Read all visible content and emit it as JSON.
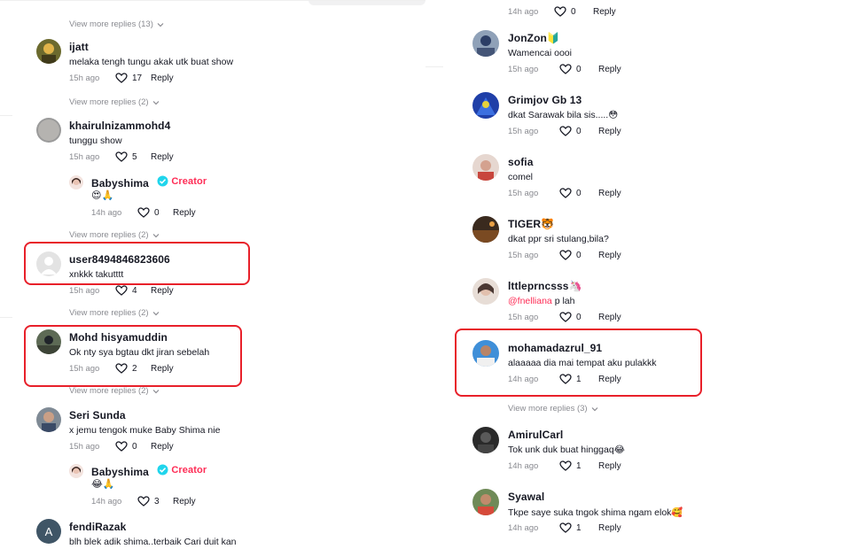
{
  "colors": {
    "accent": "#fe2c55",
    "verified": "#20d5ec",
    "highlight": "#e8202a",
    "muted": "#8a8b91"
  },
  "left": {
    "view_more_1": "View more replies (13)",
    "c1": {
      "username": "ijatt",
      "text": "melaka tengh tungu akak utk buat show",
      "time": "15h ago",
      "likes": "17",
      "reply": "Reply"
    },
    "view_more_2": "View more replies (2)",
    "c2": {
      "username": "khairulnizammohd4",
      "text": "tunggu show",
      "time": "15h ago",
      "likes": "5",
      "reply": "Reply"
    },
    "r1": {
      "username": "Babyshima",
      "creator": "Creator",
      "text": "😍🙏",
      "time": "14h ago",
      "likes": "0",
      "reply": "Reply"
    },
    "view_more_3": "View more replies (2)",
    "c3": {
      "username": "user8494846823606",
      "text": "xnkkk takutttt",
      "time": "15h ago",
      "likes": "4",
      "reply": "Reply"
    },
    "view_more_4": "View more replies (2)",
    "c4": {
      "username": "Mohd hisyamuddin",
      "text": "Ok nty sya bgtau dkt jiran sebelah",
      "time": "15h ago",
      "likes": "2",
      "reply": "Reply"
    },
    "view_more_5": "View more replies (2)",
    "c5": {
      "username": "Seri Sunda",
      "text": "x jemu tengok muke Baby Shima nie",
      "time": "15h ago",
      "likes": "0",
      "reply": "Reply"
    },
    "r2": {
      "username": "Babyshima",
      "creator": "Creator",
      "text": "😂🙏",
      "time": "14h ago",
      "likes": "3",
      "reply": "Reply"
    },
    "c6": {
      "username": "fendiRazak",
      "avatar_letter": "A",
      "text": "blh blek adik shima..terbaik Cari duit kan"
    }
  },
  "right": {
    "top": {
      "time": "14h ago",
      "likes": "0",
      "reply": "Reply"
    },
    "c1": {
      "username": "JonZon🔰",
      "text": "Wamencai oooi",
      "time": "15h ago",
      "likes": "0",
      "reply": "Reply"
    },
    "c2": {
      "username": "Grimjov Gb 13",
      "text": "dkat Sarawak bila sis.....😳",
      "time": "15h ago",
      "likes": "0",
      "reply": "Reply"
    },
    "c3": {
      "username": "sofia",
      "text": "comel",
      "time": "15h ago",
      "likes": "0",
      "reply": "Reply"
    },
    "c4": {
      "username": "TIGER🐯",
      "text": "dkat ppr sri stulang,bila?",
      "time": "15h ago",
      "likes": "0",
      "reply": "Reply"
    },
    "c5": {
      "username": "lttleprncsss🦄",
      "mention": "@fnelliana",
      "text": " p lah",
      "time": "15h ago",
      "likes": "0",
      "reply": "Reply"
    },
    "c6": {
      "username": "mohamadazrul_91",
      "text": "alaaaaa dia mai tempat aku pulakkk",
      "time": "14h ago",
      "likes": "1",
      "reply": "Reply"
    },
    "view_more": "View more replies (3)",
    "c7": {
      "username": "AmirulCarl",
      "text": "Tok unk duk buat hinggaq😂",
      "time": "14h ago",
      "likes": "1",
      "reply": "Reply"
    },
    "c8": {
      "username": "Syawal",
      "text": "Tkpe saye suka tngok shima ngam elok🥰",
      "time": "14h ago",
      "likes": "1",
      "reply": "Reply"
    }
  }
}
